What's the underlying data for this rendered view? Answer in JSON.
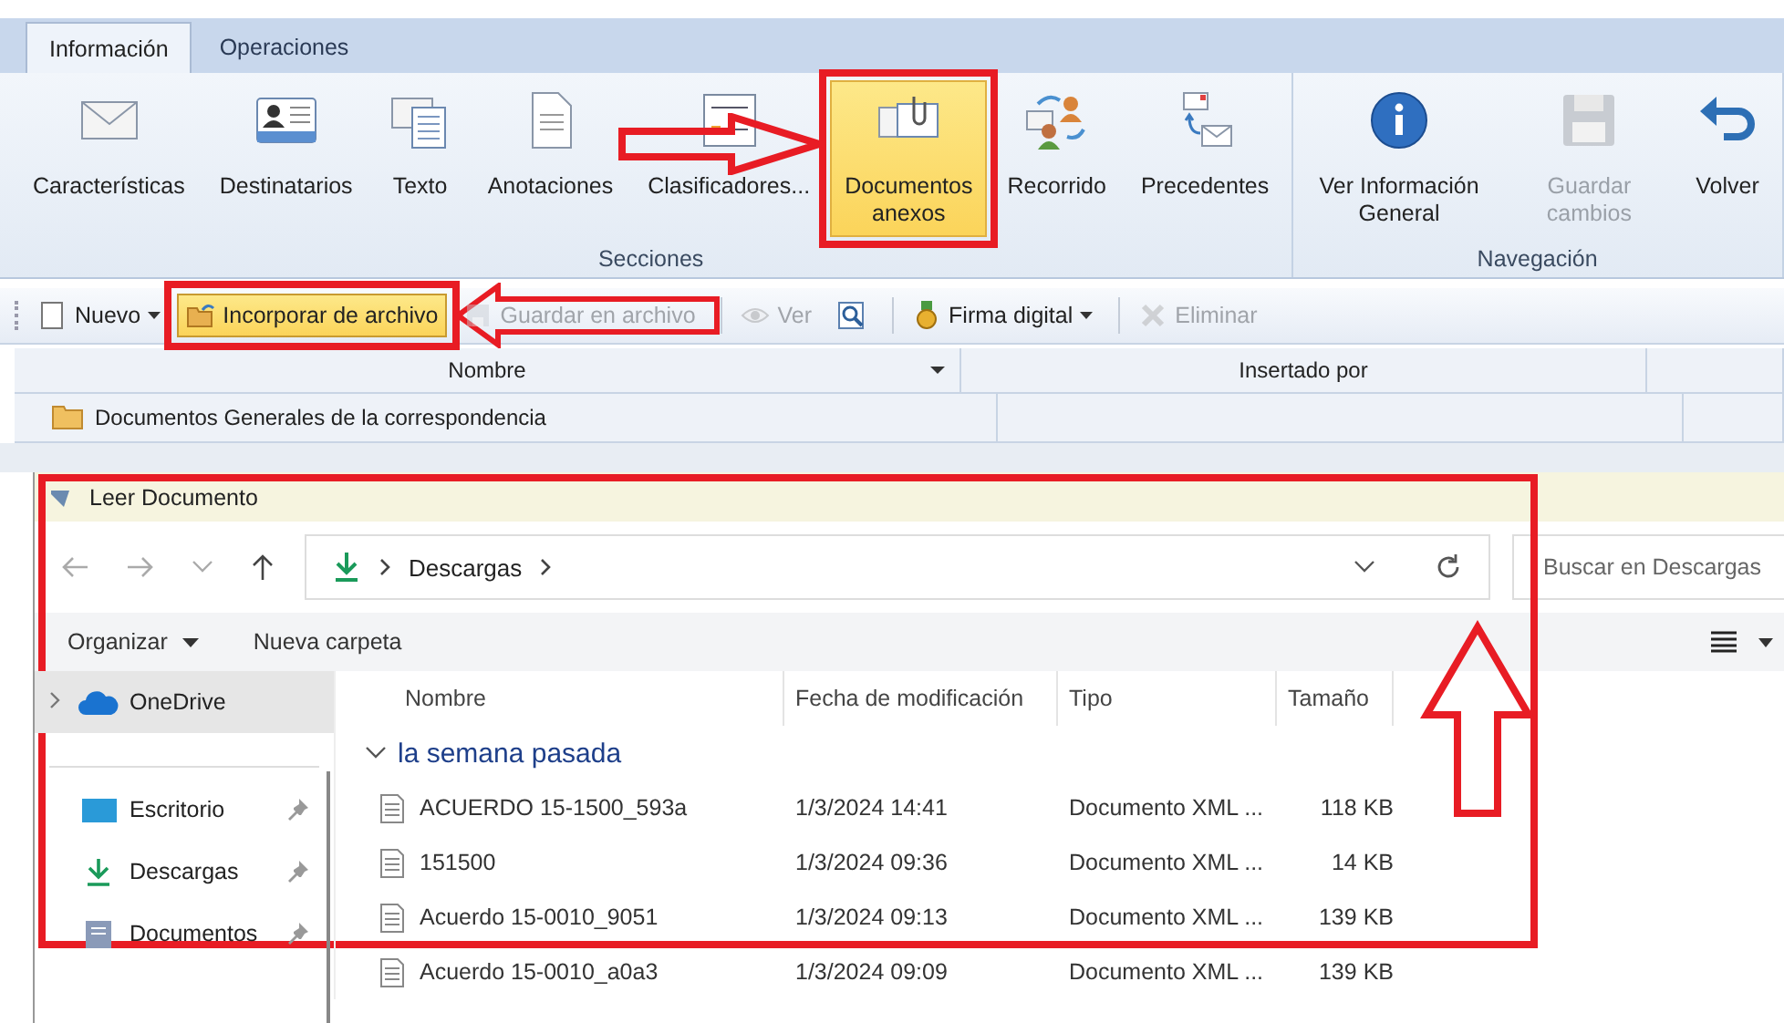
{
  "tabs": [
    {
      "label": "Información",
      "selected": true
    },
    {
      "label": "Operaciones",
      "selected": false
    }
  ],
  "ribbon": {
    "groups": [
      {
        "label": "Secciones",
        "buttons": [
          {
            "label": "Características",
            "selected": false,
            "disabled": false
          },
          {
            "label": "Destinatarios",
            "selected": false,
            "disabled": false
          },
          {
            "label": "Texto",
            "selected": false,
            "disabled": false
          },
          {
            "label": "Anotaciones",
            "selected": false,
            "disabled": false
          },
          {
            "label": "Clasificadores...",
            "selected": false,
            "disabled": false
          },
          {
            "label": "Documentos anexos",
            "selected": true,
            "disabled": false
          },
          {
            "label": "Recorrido",
            "selected": false,
            "disabled": false
          },
          {
            "label": "Precedentes",
            "selected": false,
            "disabled": false
          }
        ]
      },
      {
        "label": "Navegación",
        "buttons": [
          {
            "label": "Ver Información General",
            "selected": false,
            "disabled": false
          },
          {
            "label": "Guardar cambios",
            "selected": false,
            "disabled": true
          },
          {
            "label": "Volver",
            "selected": false,
            "disabled": false
          }
        ]
      }
    ]
  },
  "toolbar": [
    {
      "kind": "text",
      "label": "Nuevo",
      "dropdown": true,
      "disabled": false,
      "selected": false,
      "separated": false
    },
    {
      "kind": "text",
      "label": "Incorporar de archivo",
      "dropdown": false,
      "disabled": false,
      "selected": true,
      "separated": false
    },
    {
      "kind": "text",
      "label": "Guardar en archivo",
      "dropdown": false,
      "disabled": true,
      "selected": false,
      "separated": false
    },
    {
      "kind": "text",
      "label": "Ver",
      "dropdown": false,
      "disabled": true,
      "selected": false,
      "separated": true
    },
    {
      "kind": "icon",
      "dropdown": false,
      "disabled": false,
      "selected": false,
      "separated": false
    },
    {
      "kind": "text",
      "label": "Firma digital",
      "dropdown": true,
      "disabled": false,
      "selected": false,
      "separated": true
    },
    {
      "kind": "text",
      "label": "Eliminar",
      "dropdown": false,
      "disabled": true,
      "selected": false,
      "separated": true
    }
  ],
  "grid": {
    "columns": [
      "Nombre",
      "Insertado por"
    ],
    "rows": [
      {
        "name": "Documentos Generales de la correspondencia"
      }
    ]
  },
  "dialog": {
    "title": "Leer Documento",
    "address": [
      "Descargas"
    ],
    "search": {
      "placeholder": "Buscar en Descargas"
    },
    "commands": [
      {
        "label": "Organizar",
        "dropdown": true
      },
      {
        "label": "Nueva carpeta",
        "dropdown": false
      }
    ],
    "sidebar": [
      {
        "label": "OneDrive",
        "selected": true,
        "pinned": false
      },
      {
        "label": "Escritorio",
        "selected": false,
        "pinned": true
      },
      {
        "label": "Descargas",
        "selected": false,
        "pinned": true
      },
      {
        "label": "Documentos",
        "selected": false,
        "pinned": true
      }
    ],
    "columns": [
      "Nombre",
      "Fecha de modificación",
      "Tipo",
      "Tamaño"
    ],
    "group": "la semana pasada",
    "files": [
      {
        "name": "ACUERDO 15-1500_593a",
        "date": "1/3/2024 14:41",
        "type": "Documento XML ...",
        "size": "118 KB"
      },
      {
        "name": "151500",
        "date": "1/3/2024 09:36",
        "type": "Documento XML ...",
        "size": "14 KB"
      },
      {
        "name": "Acuerdo 15-0010_9051",
        "date": "1/3/2024 09:13",
        "type": "Documento XML ...",
        "size": "139 KB"
      },
      {
        "name": "Acuerdo 15-0010_a0a3",
        "date": "1/3/2024 09:09",
        "type": "Documento XML ...",
        "size": "139 KB"
      }
    ]
  }
}
